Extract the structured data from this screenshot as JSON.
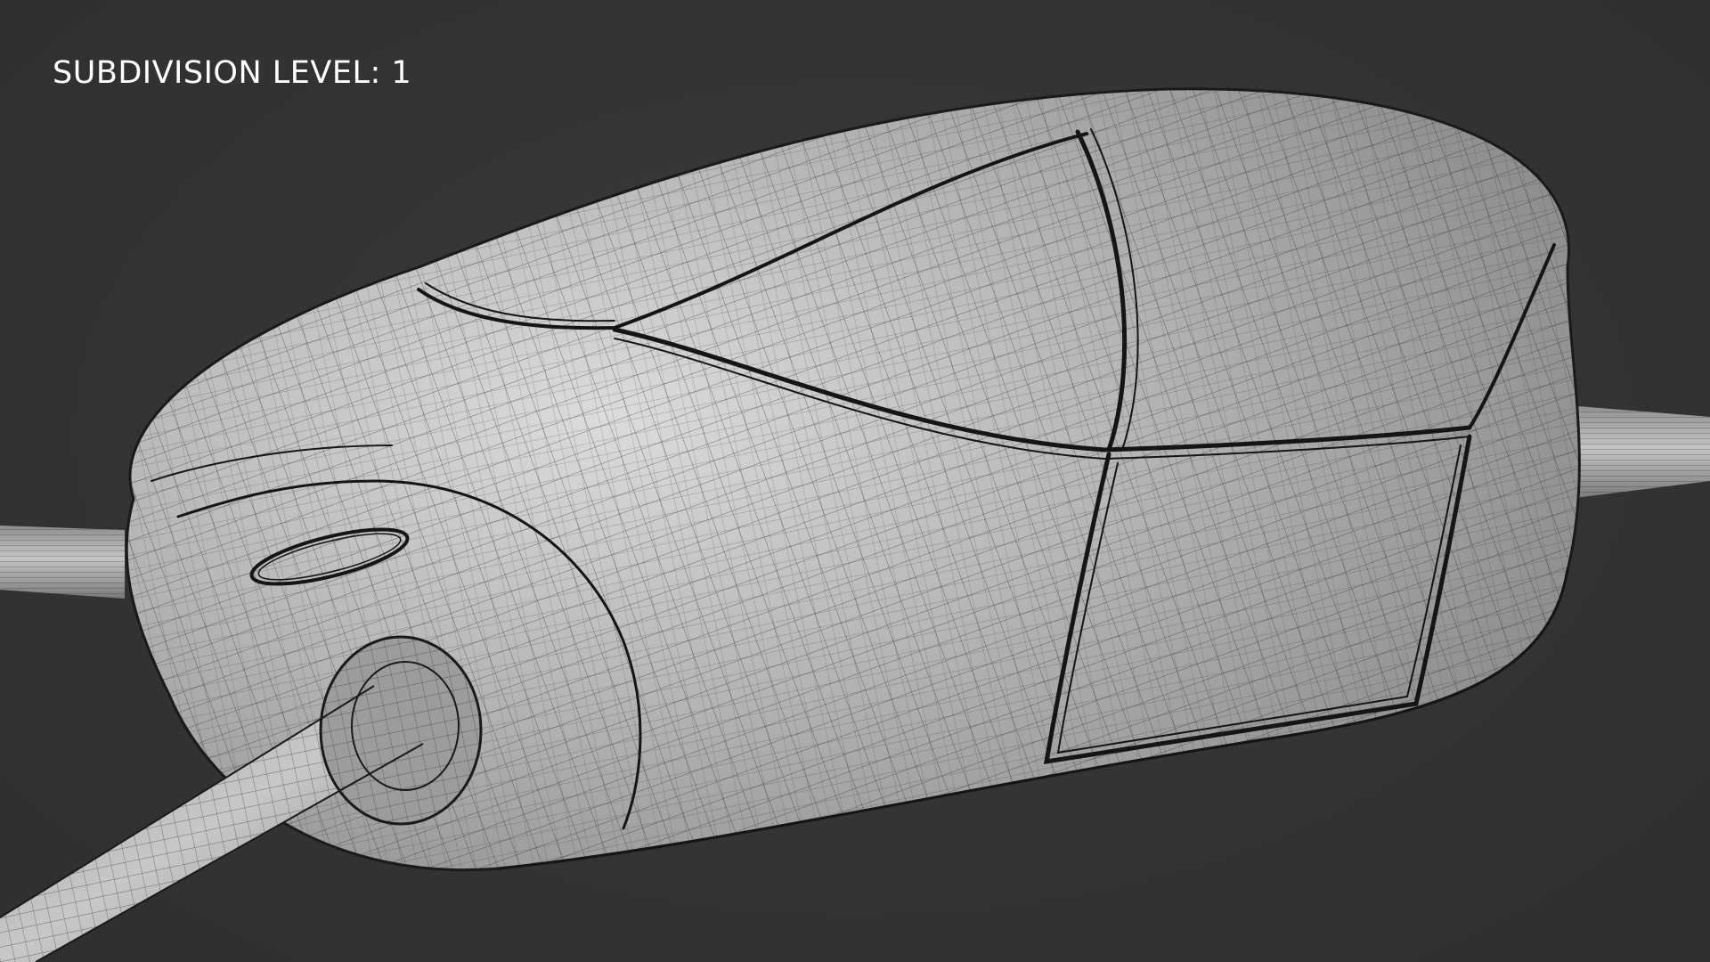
{
  "viewport": {
    "label": "SUBDIVISION LEVEL: 1",
    "background_color": "#343434",
    "label_color": "#ffffff",
    "subject": "subdivided-wireframe-pod-mesh"
  }
}
